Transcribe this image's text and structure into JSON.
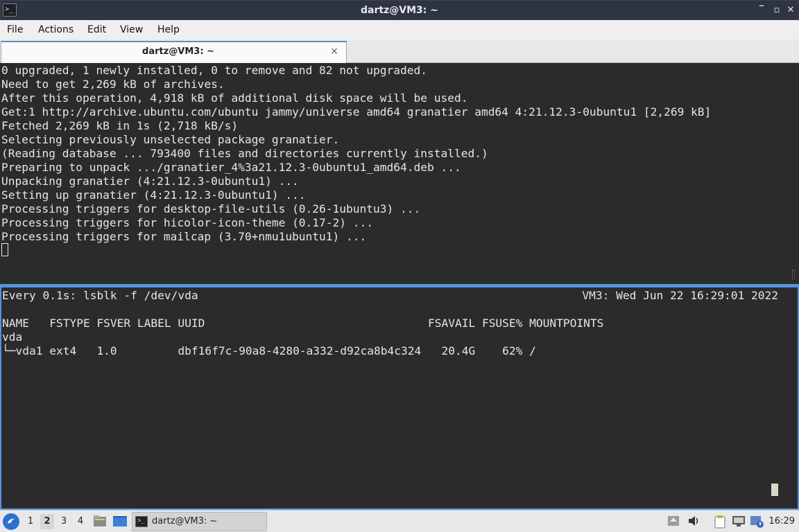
{
  "window": {
    "title": "dartz@VM3: ~",
    "app_icon_glyph": ">_",
    "buttons": {
      "minimize": "‾",
      "restore": "▫",
      "close": "✕"
    }
  },
  "menubar": {
    "items": [
      "File",
      "Actions",
      "Edit",
      "View",
      "Help"
    ]
  },
  "tabs": [
    {
      "label": "dartz@VM3: ~",
      "close": "×"
    }
  ],
  "top_pane": {
    "lines": [
      "0 upgraded, 1 newly installed, 0 to remove and 82 not upgraded.",
      "Need to get 2,269 kB of archives.",
      "After this operation, 4,918 kB of additional disk space will be used.",
      "Get:1 http://archive.ubuntu.com/ubuntu jammy/universe amd64 granatier amd64 4:21.12.3-0ubuntu1 [2,269 kB]",
      "Fetched 2,269 kB in 1s (2,718 kB/s)",
      "Selecting previously unselected package granatier.",
      "(Reading database ... 793400 files and directories currently installed.)",
      "Preparing to unpack .../granatier_4%3a21.12.3-0ubuntu1_amd64.deb ...",
      "Unpacking granatier (4:21.12.3-0ubuntu1) ...",
      "Setting up granatier (4:21.12.3-0ubuntu1) ...",
      "Processing triggers for desktop-file-utils (0.26-1ubuntu3) ...",
      "Processing triggers for hicolor-icon-theme (0.17-2) ...",
      "Processing triggers for mailcap (3.70+nmu1ubuntu1) ..."
    ]
  },
  "bottom_pane": {
    "watch_header": "Every 0.1s: lsblk -f /dev/vda",
    "watch_host_time": "VM3: Wed Jun 22 16:29:01 2022",
    "lines": [
      "",
      "NAME   FSTYPE FSVER LABEL UUID                                 FSAVAIL FSUSE% MOUNTPOINTS",
      "vda",
      "└─vda1 ext4   1.0         dbf16f7c-90a8-4280-a332-d92ca8b4c324   20.4G    62% /"
    ]
  },
  "taskbar": {
    "start_icon": "start-menu-icon",
    "desktops": [
      "1",
      "2",
      "3",
      "4"
    ],
    "active_desktop": "2",
    "task_label": "dartz@VM3: ~",
    "clock": "16:29"
  },
  "colors": {
    "terminal_bg": "#2b2b2b",
    "terminal_fg": "#e6e6e6",
    "accent": "#5294e2",
    "titlebar_bg": "#2e3440"
  }
}
